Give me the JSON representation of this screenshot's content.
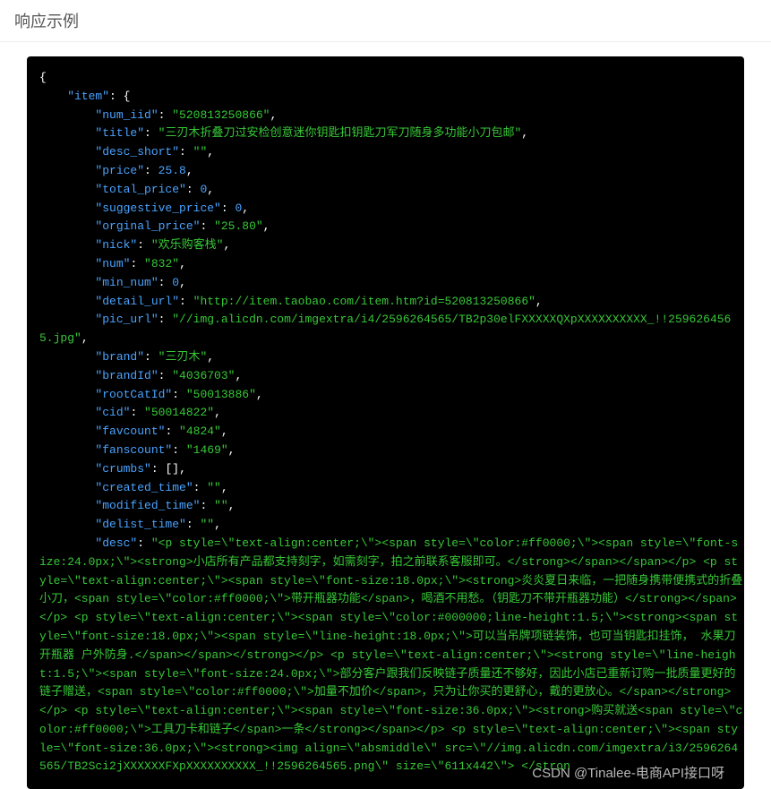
{
  "heading": "响应示例",
  "watermark": "CSDN @Tinalee-电商API接口呀",
  "code_tokens": [
    [
      "p",
      "{"
    ],
    "\n",
    "    ",
    [
      "k",
      "\"item\""
    ],
    [
      "p",
      ": "
    ],
    [
      "p",
      "{"
    ],
    "\n",
    "        ",
    [
      "k",
      "\"num_iid\""
    ],
    [
      "p",
      ": "
    ],
    [
      "s",
      "\"520813250866\""
    ],
    [
      "p",
      ","
    ],
    "\n",
    "        ",
    [
      "k",
      "\"title\""
    ],
    [
      "p",
      ": "
    ],
    [
      "s",
      "\"三刃木折叠刀过安检创意迷你钥匙扣钥匙刀军刀随身多功能小刀包邮\""
    ],
    [
      "p",
      ","
    ],
    "\n",
    "        ",
    [
      "k",
      "\"desc_short\""
    ],
    [
      "p",
      ": "
    ],
    [
      "s",
      "\"\""
    ],
    [
      "p",
      ","
    ],
    "\n",
    "        ",
    [
      "k",
      "\"price\""
    ],
    [
      "p",
      ": "
    ],
    [
      "n",
      "25.8"
    ],
    [
      "p",
      ","
    ],
    "\n",
    "        ",
    [
      "k",
      "\"total_price\""
    ],
    [
      "p",
      ": "
    ],
    [
      "n",
      "0"
    ],
    [
      "p",
      ","
    ],
    "\n",
    "        ",
    [
      "k",
      "\"suggestive_price\""
    ],
    [
      "p",
      ": "
    ],
    [
      "n",
      "0"
    ],
    [
      "p",
      ","
    ],
    "\n",
    "        ",
    [
      "k",
      "\"orginal_price\""
    ],
    [
      "p",
      ": "
    ],
    [
      "s",
      "\"25.80\""
    ],
    [
      "p",
      ","
    ],
    "\n",
    "        ",
    [
      "k",
      "\"nick\""
    ],
    [
      "p",
      ": "
    ],
    [
      "s",
      "\"欢乐购客栈\""
    ],
    [
      "p",
      ","
    ],
    "\n",
    "        ",
    [
      "k",
      "\"num\""
    ],
    [
      "p",
      ": "
    ],
    [
      "s",
      "\"832\""
    ],
    [
      "p",
      ","
    ],
    "\n",
    "        ",
    [
      "k",
      "\"min_num\""
    ],
    [
      "p",
      ": "
    ],
    [
      "n",
      "0"
    ],
    [
      "p",
      ","
    ],
    "\n",
    "        ",
    [
      "k",
      "\"detail_url\""
    ],
    [
      "p",
      ": "
    ],
    [
      "s",
      "\"http://item.taobao.com/item.htm?id=520813250866\""
    ],
    [
      "p",
      ","
    ],
    "\n",
    "        ",
    [
      "k",
      "\"pic_url\""
    ],
    [
      "p",
      ": "
    ],
    [
      "s",
      "\"//img.alicdn.com/imgextra/i4/2596264565/TB2p30elFXXXXXQXpXXXXXXXXXX_!!2596264565.jpg\""
    ],
    [
      "p",
      ","
    ],
    "\n",
    "        ",
    [
      "k",
      "\"brand\""
    ],
    [
      "p",
      ": "
    ],
    [
      "s",
      "\"三刃木\""
    ],
    [
      "p",
      ","
    ],
    "\n",
    "        ",
    [
      "k",
      "\"brandId\""
    ],
    [
      "p",
      ": "
    ],
    [
      "s",
      "\"4036703\""
    ],
    [
      "p",
      ","
    ],
    "\n",
    "        ",
    [
      "k",
      "\"rootCatId\""
    ],
    [
      "p",
      ": "
    ],
    [
      "s",
      "\"50013886\""
    ],
    [
      "p",
      ","
    ],
    "\n",
    "        ",
    [
      "k",
      "\"cid\""
    ],
    [
      "p",
      ": "
    ],
    [
      "s",
      "\"50014822\""
    ],
    [
      "p",
      ","
    ],
    "\n",
    "        ",
    [
      "k",
      "\"favcount\""
    ],
    [
      "p",
      ": "
    ],
    [
      "s",
      "\"4824\""
    ],
    [
      "p",
      ","
    ],
    "\n",
    "        ",
    [
      "k",
      "\"fanscount\""
    ],
    [
      "p",
      ": "
    ],
    [
      "s",
      "\"1469\""
    ],
    [
      "p",
      ","
    ],
    "\n",
    "        ",
    [
      "k",
      "\"crumbs\""
    ],
    [
      "p",
      ": "
    ],
    [
      "p",
      "[]"
    ],
    [
      "p",
      ","
    ],
    "\n",
    "        ",
    [
      "k",
      "\"created_time\""
    ],
    [
      "p",
      ": "
    ],
    [
      "s",
      "\"\""
    ],
    [
      "p",
      ","
    ],
    "\n",
    "        ",
    [
      "k",
      "\"modified_time\""
    ],
    [
      "p",
      ": "
    ],
    [
      "s",
      "\"\""
    ],
    [
      "p",
      ","
    ],
    "\n",
    "        ",
    [
      "k",
      "\"delist_time\""
    ],
    [
      "p",
      ": "
    ],
    [
      "s",
      "\"\""
    ],
    [
      "p",
      ","
    ],
    "\n",
    "        ",
    [
      "k",
      "\"desc\""
    ],
    [
      "p",
      ": "
    ],
    [
      "s",
      "\"<p style=\\\"text-align:center;\\\"><span style=\\\"color:#ff0000;\\\"><span style=\\\"font-size:24.0px;\\\"><strong>小店所有产品都支持刻字，如需刻字，拍之前联系客服即可。</strong></span></span></p> <p style=\\\"text-align:center;\\\"><span style=\\\"font-size:18.0px;\\\"><strong>炎炎夏日来临，一把随身携带便携式的折叠小刀，<span style=\\\"color:#ff0000;\\\">带开瓶器功能</span>，喝酒不用愁。（钥匙刀不带开瓶器功能）</strong></span></p> <p style=\\\"text-align:center;\\\"><span style=\\\"color:#000000;line-height:1.5;\\\"><strong><span style=\\\"font-size:18.0px;\\\"><span style=\\\"line-height:18.0px;\\\">可以当吊牌项链装饰，也可当钥匙扣挂饰， 水果刀 开瓶器 户外防身.</span></span></strong></p> <p style=\\\"text-align:center;\\\"><strong style=\\\"line-height:1.5;\\\"><span style=\\\"font-size:24.0px;\\\">部分客户跟我们反映链子质量还不够好，因此小店已重新订购一批质量更好的链子赠送，<span style=\\\"color:#ff0000;\\\">加量不加价</span>，只为让你买的更舒心，戴的更放心。</span></strong></p> <p style=\\\"text-align:center;\\\"><span style=\\\"font-size:36.0px;\\\"><strong>购买就送<span style=\\\"color:#ff0000;\\\">工具刀卡和链子</span>一条</strong></span></p> <p style=\\\"text-align:center;\\\"><span style=\\\"font-size:36.0px;\\\"><strong><img align=\\\"absmiddle\\\" src=\\\"//img.alicdn.com/imgextra/i3/2596264565/TB2Sci2jXXXXXXFXpXXXXXXXXXX_!!2596264565.png\\\" size=\\\"611x442\\\"> </stron"
    ]
  ]
}
